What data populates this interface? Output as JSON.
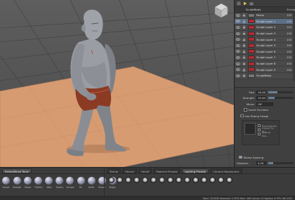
{
  "window": {
    "title": ""
  },
  "layers": {
    "header": {
      "name": "SculptBody",
      "value": "Strength"
    },
    "items": [
      {
        "name": "Pelvis",
        "value": "100",
        "selected": false,
        "base": true
      },
      {
        "name": "Sculpt Layer 1",
        "value": "100",
        "selected": true,
        "base": false
      },
      {
        "name": "Sculpt Layer 2",
        "value": "100",
        "selected": false,
        "base": false
      },
      {
        "name": "Sculpt Layer 3",
        "value": "100",
        "selected": false,
        "base": false
      },
      {
        "name": "Sculpt Layer 4",
        "value": "100",
        "selected": false,
        "base": false
      },
      {
        "name": "Sculpt Layer 5",
        "value": "100",
        "selected": false,
        "base": false
      },
      {
        "name": "Sculpt Layer 6",
        "value": "100",
        "selected": false,
        "base": false
      },
      {
        "name": "Sculpt Layer 7",
        "value": "100",
        "selected": false,
        "base": false
      },
      {
        "name": "Sculpt Layer 8",
        "value": "100",
        "selected": false,
        "base": false
      },
      {
        "name": "Sculpt Layer 9",
        "value": "100",
        "selected": false,
        "base": false
      },
      {
        "name": "SculptBody",
        "value": "",
        "selected": false,
        "base": true
      }
    ]
  },
  "properties": {
    "size": {
      "label": "Size",
      "value": "16.46",
      "level": 0.35
    },
    "strength": {
      "label": "Strength",
      "value": "10.40",
      "level": 0.25
    },
    "mirror": {
      "label": "Mirror",
      "value": "Off"
    },
    "invert": {
      "label": "Invert Function"
    },
    "use_stamp": {
      "label": "Use Stamp Image"
    },
    "stamp_opts": [
      "Randomize",
      "Orient To Str...",
      "Stamp Rot..."
    ],
    "stamp_spacing": {
      "label": "Stamp Spacing",
      "checked": true
    },
    "distance": {
      "label": "Distance",
      "value": "4.20",
      "level": 0.2
    }
  },
  "shelf": {
    "tabs": [
      "Select/Move Tools"
    ],
    "tools": [
      {
        "label": "Sculpt"
      },
      {
        "label": "Smooth"
      },
      {
        "label": "Relax"
      },
      {
        "label": "Flatten"
      },
      {
        "label": "Wax"
      },
      {
        "label": "Foamy"
      },
      {
        "label": "Scrape"
      },
      {
        "label": "Fill"
      },
      {
        "label": "Knife"
      },
      {
        "label": "Smear"
      },
      {
        "label": "Bulge"
      }
    ]
  },
  "stamps": {
    "tabs": [
      "Stamp",
      "Stencil",
      "Falloff",
      "Material Presets",
      "Lighting Presets",
      "Camera Bookmarks"
    ],
    "active_tab": "Lighting Presets",
    "count": 15
  },
  "status": {
    "text": "Total: 251008  Selected: 0  GPU Mem: 863  Active: 6  Highest: 6  FPS: 98.2039"
  },
  "colors": {
    "accent": "#5b6f86",
    "layer_swatch": "#ad2b33",
    "floor": "#d99c73"
  }
}
